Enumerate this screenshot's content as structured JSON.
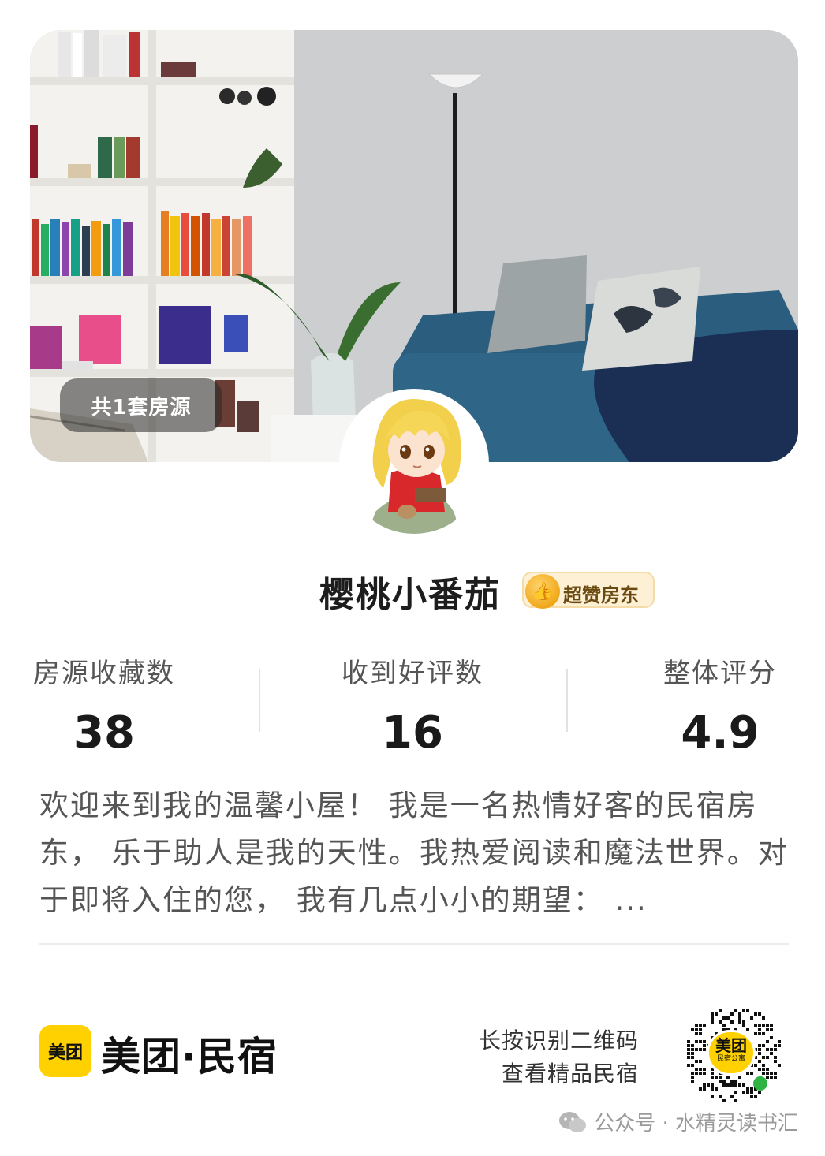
{
  "hero": {
    "listing_count_badge": "共1套房源"
  },
  "host": {
    "name": "樱桃小番茄",
    "badge_label": "超赞房东",
    "badge_icon": "thumbs-up-icon"
  },
  "stats": [
    {
      "label": "房源收藏数",
      "value": "38"
    },
    {
      "label": "收到好评数",
      "value": "16"
    },
    {
      "label": "整体评分",
      "value": "4.9"
    }
  ],
  "bio": "欢迎来到我的温馨小屋！ 我是一名热情好客的民宿房东， 乐于助人是我的天性。我热爱阅读和魔法世界。对于即将入住的您， 我有几点小小的期望： ...",
  "footer": {
    "logo_text": "美团",
    "brand": "美团·民宿",
    "scan_line1": "长按识别二维码",
    "scan_line2": "查看精品民宿",
    "qr_center_text": "美团",
    "qr_center_sub": "民宿公寓"
  },
  "watermark": {
    "text": "公众号 · 水精灵读书汇",
    "icon": "wechat-icon"
  },
  "colors": {
    "brand_yellow": "#ffd100",
    "sofa_blue": "#2b5e7e"
  }
}
